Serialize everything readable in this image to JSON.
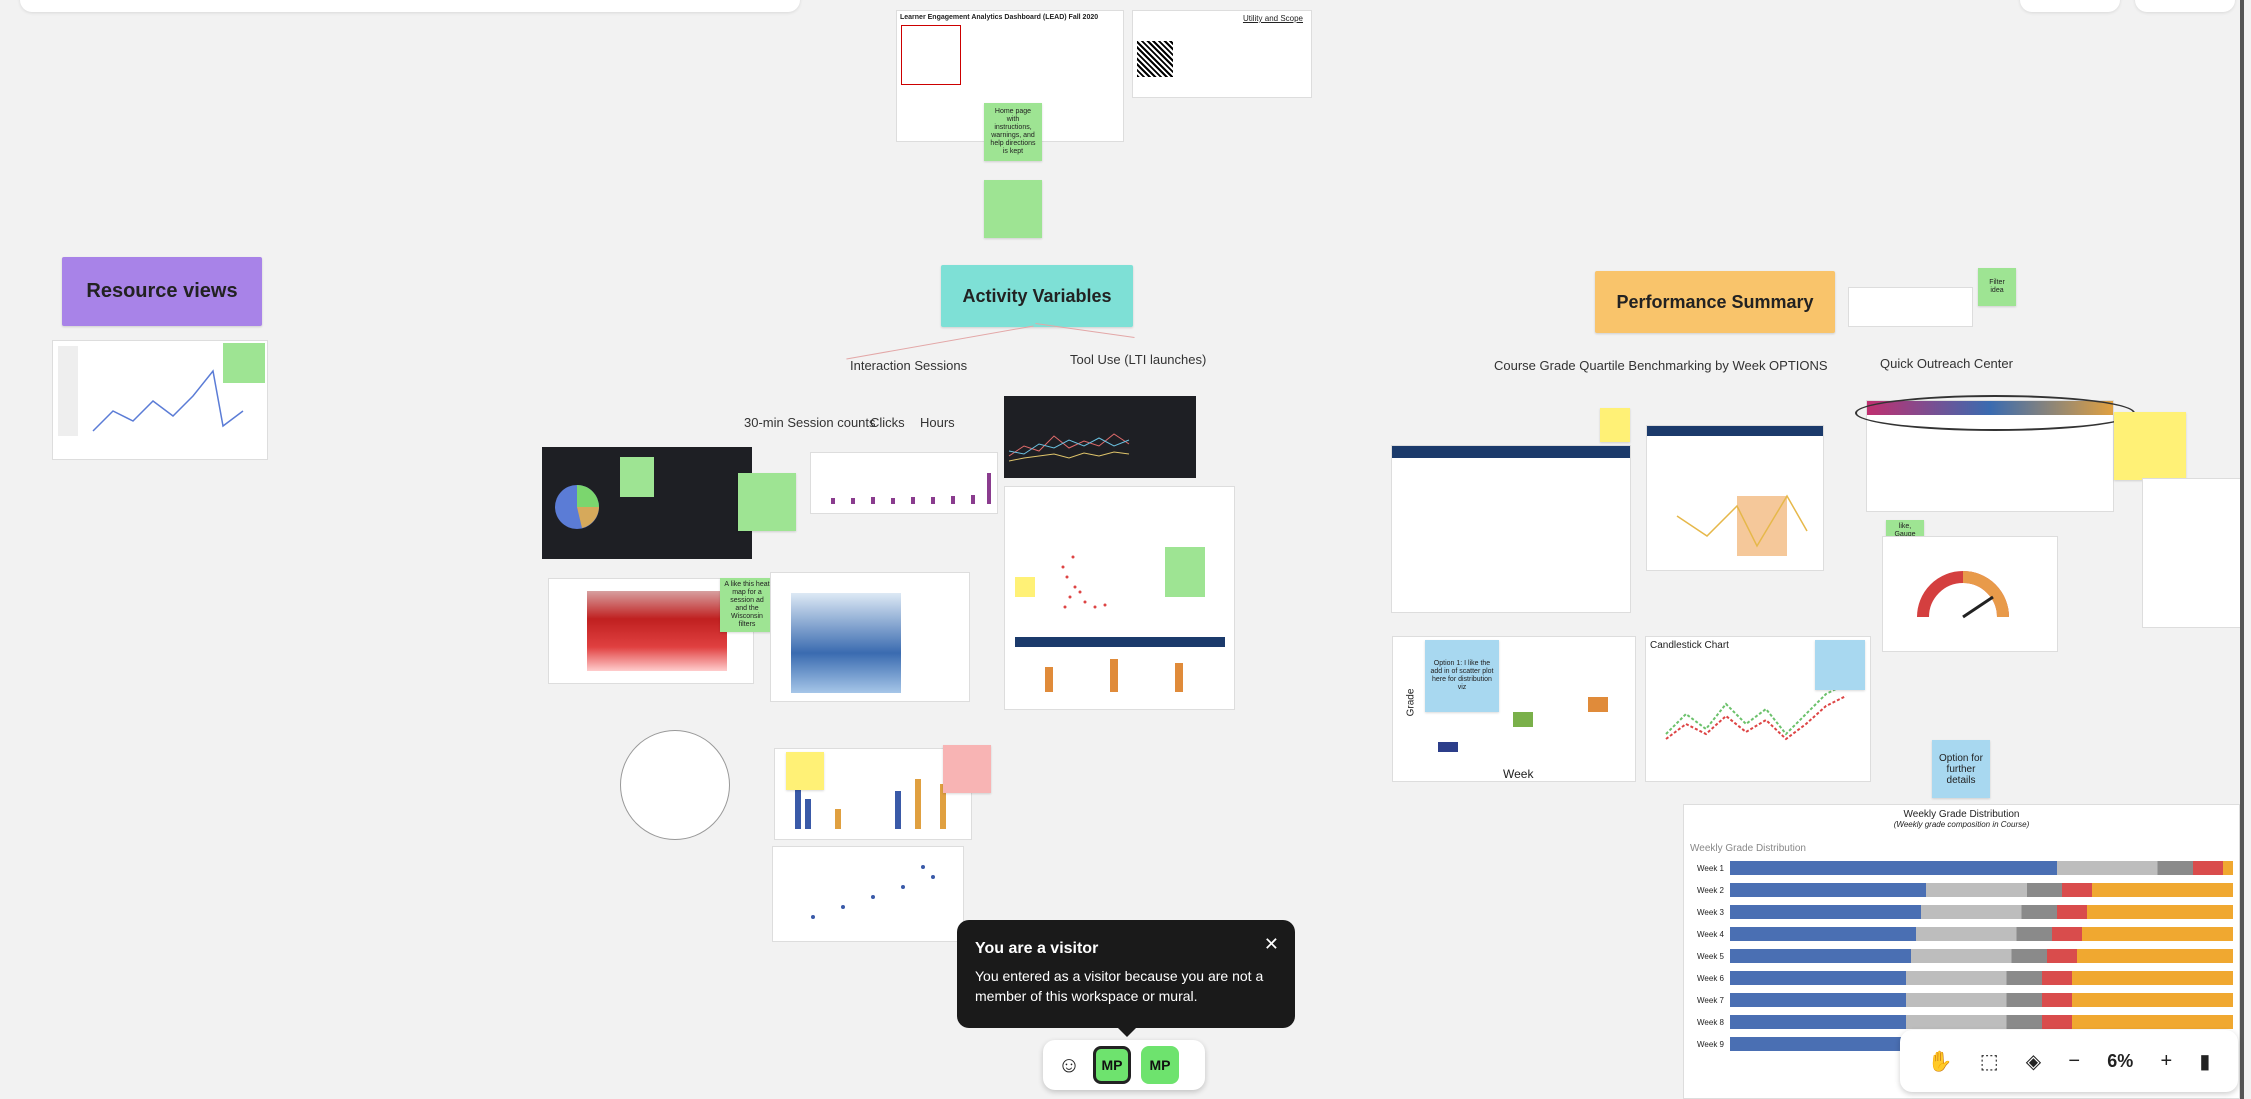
{
  "board": {
    "resource_views": "Resource views",
    "activity_variables": "Activity Variables",
    "performance_summary": "Performance Summary",
    "interaction_sessions": "Interaction Sessions",
    "tool_use": "Tool Use (LTI launches)",
    "session_counts": "30-min Session counts",
    "clicks": "Clicks",
    "hours": "Hours",
    "course_grade_quartile": "Course Grade Quartile Benchmarking by Week OPTIONS",
    "quick_outreach": "Quick Outreach Center",
    "utility_scope": "Utility and Scope",
    "dashboard_title": "Learner Engagement Analytics Dashboard (LEAD) Fall 2020",
    "candlestick": "Candlestick Chart",
    "weekly_grade_dist": "Weekly Grade Distribution",
    "weekly_grade_sub": "(Weekly grade composition in Course)",
    "weekly_grade_dist_label": "Weekly Grade Distribution",
    "week_axis": "Week",
    "grade_axis": "Grade",
    "rows": [
      "Week 1",
      "Week 2",
      "Week 3",
      "Week 4",
      "Week 5",
      "Week 6",
      "Week 7",
      "Week 8",
      "Week 9"
    ]
  },
  "stickies": {
    "home_page": "Home page with instructions, warnings, and help directions is kept",
    "filter_idea": "Filter idea",
    "heat_map": "A like this heat map for a session ad and the Wisconsin filters",
    "option1": "Option 1: I like the add in of scatter plot here for distribution viz",
    "option_further": "Option for further details",
    "gauge": "It is a like, Gauge chart with median arrow"
  },
  "tooltip": {
    "title": "You are a visitor",
    "body": "You entered as a visitor because you are not a member of this workspace or mural.",
    "close": "✕"
  },
  "collaborators": {
    "emoji": "☺",
    "avatar1": "MP",
    "avatar2": "MP"
  },
  "zoom": {
    "level": "6%",
    "minus": "−",
    "plus": "+"
  },
  "colors": {
    "purple": "#a883e8",
    "teal": "#7ee0d6",
    "orange": "#f9c46b"
  }
}
